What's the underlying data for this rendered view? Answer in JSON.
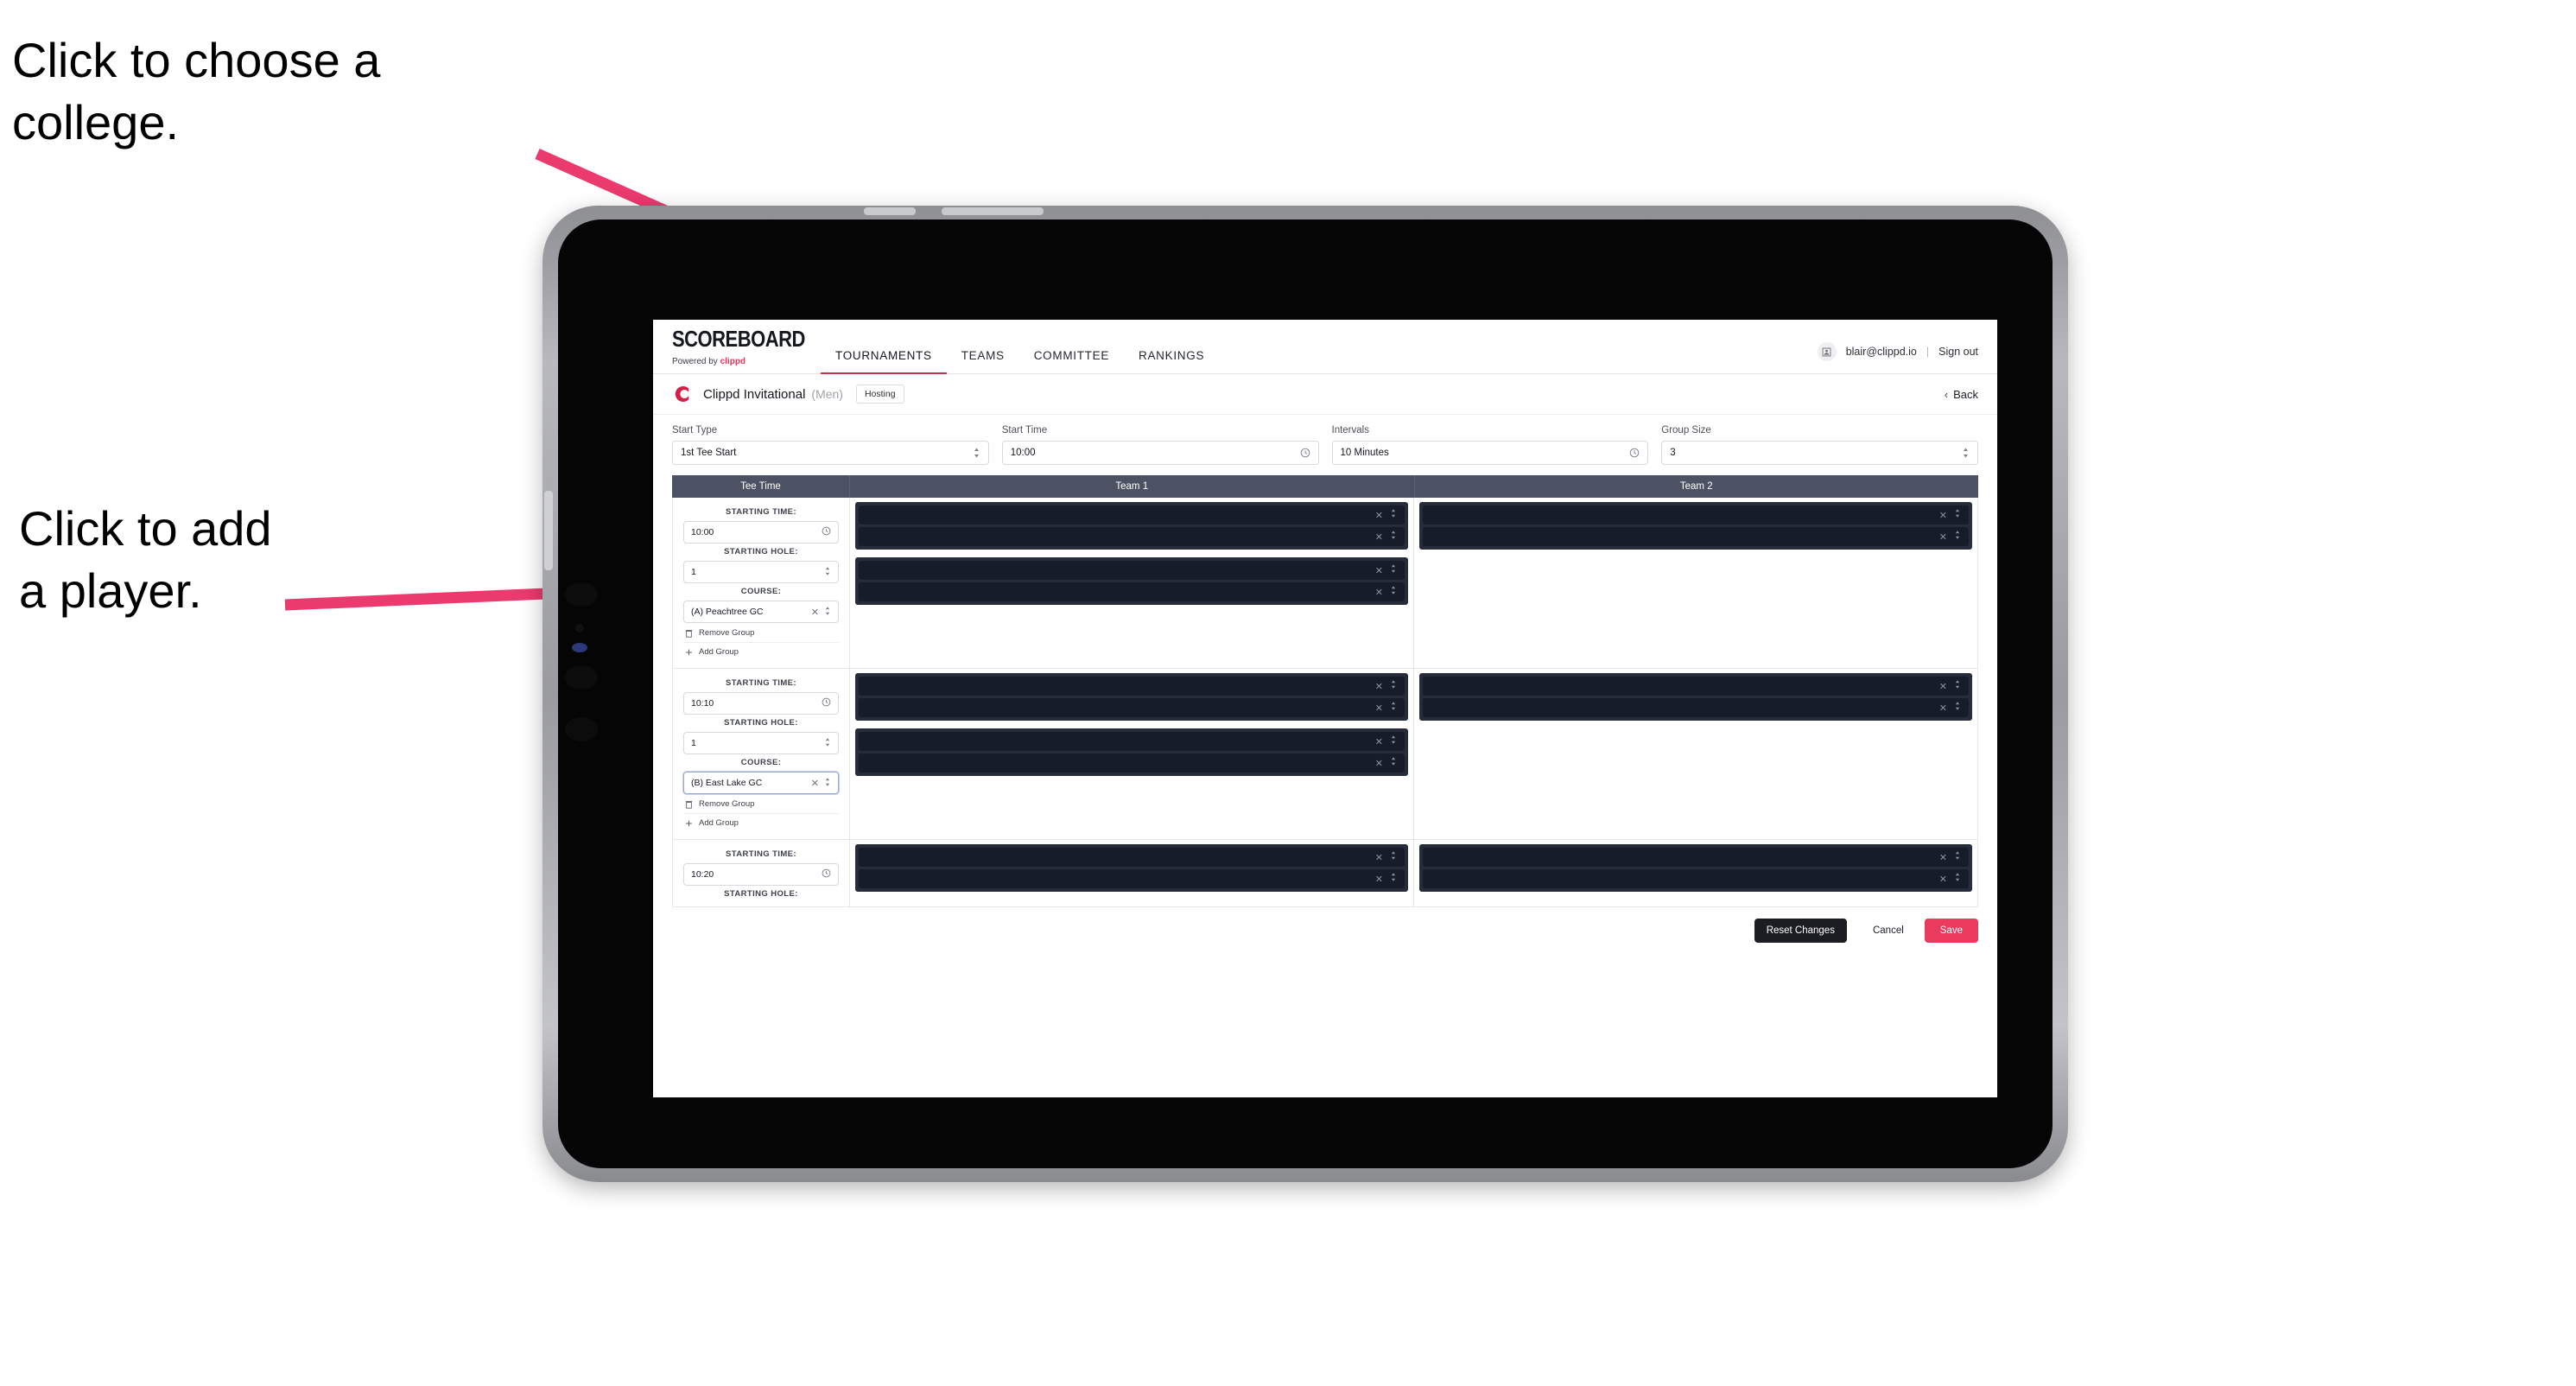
{
  "annotations": [
    {
      "id": "choose-college",
      "text": "Click to choose a\ncollege."
    },
    {
      "id": "add-player",
      "text": "Click to add\na player."
    }
  ],
  "colors": {
    "accent_pink": "#ea3a5d",
    "tab_underline": "#c2344e",
    "table_header_bg": "#4c5163",
    "player_block_bg": "#262c3a",
    "player_row_bg": "#161c28",
    "dark_button": "#1b1d23"
  },
  "topnav": {
    "logo_word": "SCOREBOARD",
    "logo_sub_prefix": "Powered by",
    "logo_sub_brand": "clippd",
    "tabs": [
      {
        "label": "TOURNAMENTS",
        "active": true
      },
      {
        "label": "TEAMS",
        "active": false
      },
      {
        "label": "COMMITTEE",
        "active": false
      },
      {
        "label": "RANKINGS",
        "active": false
      }
    ],
    "account": {
      "avatar_icon": "user-icon",
      "email": "blair@clippd.io",
      "separator": "|",
      "sign_out": "Sign out"
    }
  },
  "tournament_bar": {
    "logo_icon": "clippd-c-logo",
    "name": "Clippd Invitational",
    "gender": "(Men)",
    "badge": "Hosting",
    "back_icon": "chevron-left-icon",
    "back_label": "Back"
  },
  "filters": [
    {
      "label": "Start Type",
      "value": "1st Tee Start",
      "adorn": "stepper-icon"
    },
    {
      "label": "Start Time",
      "value": "10:00",
      "adorn": "clock-icon"
    },
    {
      "label": "Intervals",
      "value": "10 Minutes",
      "adorn": "clock-icon"
    },
    {
      "label": "Group Size",
      "value": "3",
      "adorn": "stepper-icon"
    }
  ],
  "table": {
    "headers": [
      "Tee Time",
      "Team 1",
      "Team 2"
    ],
    "field_labels": {
      "time": "STARTING TIME:",
      "hole": "STARTING HOLE:",
      "course": "COURSE:"
    },
    "group_actions": {
      "remove": "Remove Group",
      "add": "Add Group",
      "remove_icon": "trash-icon",
      "add_icon": "plus-icon"
    },
    "rows": [
      {
        "time": "10:00",
        "hole": "1",
        "course": "(A) Peachtree GC",
        "course_focused": false,
        "team1_blocks": [
          2,
          2
        ],
        "team2_blocks": [
          2
        ]
      },
      {
        "time": "10:10",
        "hole": "1",
        "course": "(B) East Lake GC",
        "course_focused": true,
        "team1_blocks": [
          2,
          2
        ],
        "team2_blocks": [
          2
        ]
      },
      {
        "time": "10:20",
        "hole": "",
        "course": "",
        "course_focused": false,
        "team1_blocks": [
          2
        ],
        "team2_blocks": [
          2
        ]
      }
    ]
  },
  "footer": {
    "reset": "Reset Changes",
    "cancel": "Cancel",
    "save": "Save"
  }
}
